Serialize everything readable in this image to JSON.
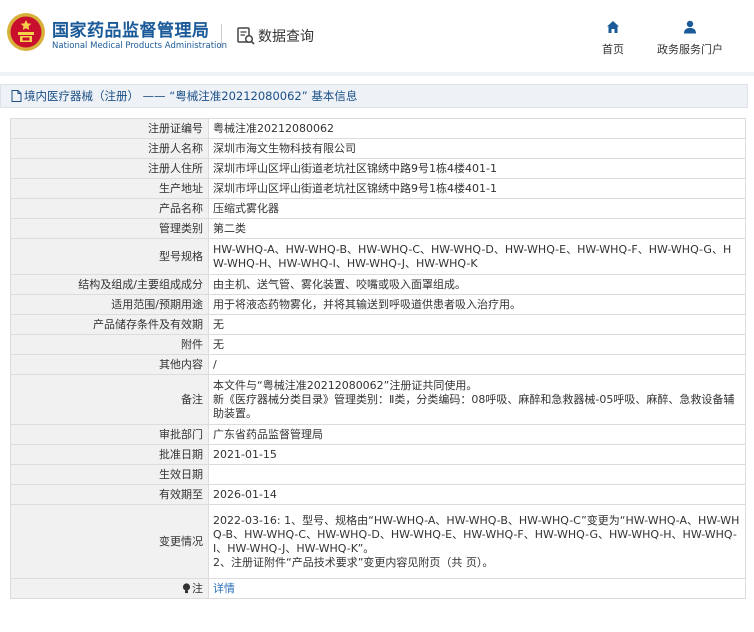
{
  "header": {
    "brand_cn": "国家药品监督管理局",
    "brand_en": "National Medical Products Administration",
    "section_title": "数据查询",
    "nav": {
      "home": "首页",
      "service": "政务服务门户"
    }
  },
  "breadcrumb": {
    "text": "境内医疗器械（注册） —— “粤械注准20212080062” 基本信息"
  },
  "rows": [
    {
      "label": "注册证编号",
      "value": "粤械注准20212080062"
    },
    {
      "label": "注册人名称",
      "value": "深圳市海文生物科技有限公司"
    },
    {
      "label": "注册人住所",
      "value": "深圳市坪山区坪山街道老坑社区锦绣中路9号1栋4楼401-1"
    },
    {
      "label": "生产地址",
      "value": "深圳市坪山区坪山街道老坑社区锦绣中路9号1栋4楼401-1"
    },
    {
      "label": "产品名称",
      "value": "压缩式雾化器"
    },
    {
      "label": "管理类别",
      "value": "第二类"
    },
    {
      "label": "型号规格",
      "value": "HW-WHQ-A、HW-WHQ-B、HW-WHQ-C、HW-WHQ-D、HW-WHQ-E、HW-WHQ-F、HW-WHQ-G、HW-WHQ-H、HW-WHQ-I、HW-WHQ-J、HW-WHQ-K"
    },
    {
      "label": "结构及组成/主要组成成分",
      "value": "由主机、送气管、雾化装置、咬嘴或吸入面罩组成。"
    },
    {
      "label": "适用范围/预期用途",
      "value": "用于将液态药物雾化，并将其输送到呼吸道供患者吸入治疗用。"
    },
    {
      "label": "产品储存条件及有效期",
      "value": "无"
    },
    {
      "label": "附件",
      "value": "无"
    },
    {
      "label": "其他内容",
      "value": "/"
    },
    {
      "label": "备注",
      "value": "本文件与“粤械注准20212080062”注册证共同使用。\n新《医疗器械分类目录》管理类别：Ⅱ类，分类编码：08呼吸、麻醉和急救器械-05呼吸、麻醉、急救设备辅助装置。"
    },
    {
      "label": "审批部门",
      "value": "广东省药品监督管理局"
    },
    {
      "label": "批准日期",
      "value": "2021-01-15"
    },
    {
      "label": "生效日期",
      "value": ""
    },
    {
      "label": "有效期至",
      "value": "2026-01-14"
    },
    {
      "label": "变更情况",
      "value": "2022-03-16: 1、型号、规格由“HW-WHQ-A、HW-WHQ-B、HW-WHQ-C”变更为“HW-WHQ-A、HW-WHQ-B、HW-WHQ-C、HW-WHQ-D、HW-WHQ-E、HW-WHQ-F、HW-WHQ-G、HW-WHQ-H、HW-WHQ-I、HW-WHQ-J、HW-WHQ-K”。\n2、注册证附件“产品技术要求”变更内容见附页（共 页）。"
    }
  ],
  "note": {
    "label": "注",
    "link": "详情"
  },
  "colors": {
    "brand": "#1a5a98",
    "link": "#2a6fbb",
    "label_bg": "#f1f1f1",
    "border": "#dcdcdc"
  },
  "icons": {
    "logo": "nmpa-emblem",
    "query": "search-document-icon",
    "home": "home-icon",
    "service": "user-icon",
    "breadcrumb": "document-icon",
    "note": "lightbulb-icon"
  }
}
